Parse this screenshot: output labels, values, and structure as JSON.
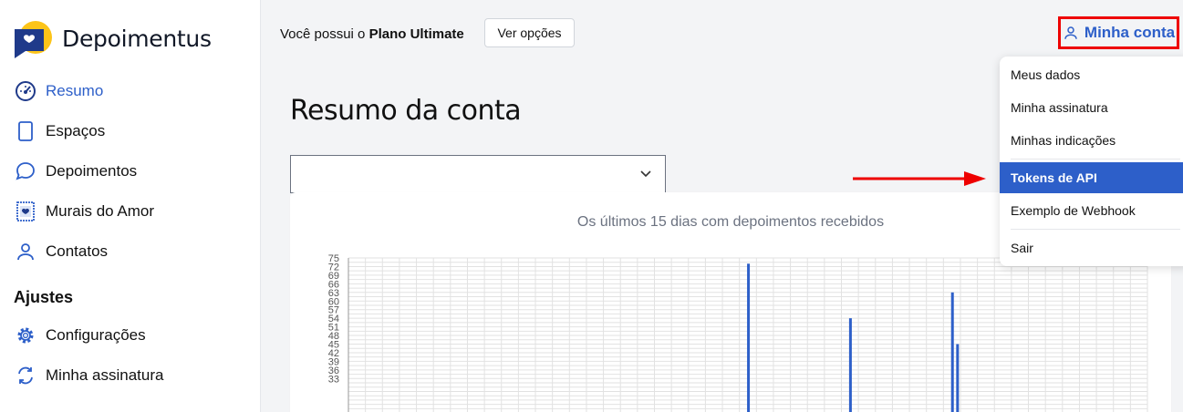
{
  "brand": {
    "name": "Depoimentus"
  },
  "sidebar": {
    "items": [
      {
        "label": "Resumo",
        "icon": "gauge-icon",
        "active": true
      },
      {
        "label": "Espaços",
        "icon": "tablet-icon"
      },
      {
        "label": "Depoimentos",
        "icon": "chat-bubble-icon"
      },
      {
        "label": "Murais do Amor",
        "icon": "heart-frame-icon"
      },
      {
        "label": "Contatos",
        "icon": "user-icon"
      }
    ],
    "section_title": "Ajustes",
    "settings_items": [
      {
        "label": "Configurações",
        "icon": "gear-icon"
      },
      {
        "label": "Minha assinatura",
        "icon": "refresh-icon"
      }
    ]
  },
  "topbar": {
    "plan_prefix": "Você possui o",
    "plan_name": "Plano Ultimate",
    "options_button": "Ver opções",
    "account_button": "Minha conta"
  },
  "main": {
    "title": "Resumo da conta",
    "select_value": ""
  },
  "dropdown": {
    "items": [
      "Meus dados",
      "Minha assinatura",
      "Minhas indicações",
      "Tokens de API",
      "Exemplo de Webhook",
      "Sair"
    ],
    "active": "Tokens de API"
  },
  "colors": {
    "accent": "#2d5fc9",
    "highlight": "#e00000"
  },
  "chart_data": {
    "type": "bar",
    "title": "Os últimos 15 dias com depoimentos recebidos",
    "y_ticks": [
      75,
      72,
      69,
      66,
      63,
      60,
      57,
      54,
      51,
      48,
      45,
      42,
      39,
      36,
      33
    ],
    "ylim": [
      33,
      75
    ],
    "bars": [
      {
        "x_index": 23,
        "value": 73
      },
      {
        "x_index": 29,
        "value": 54
      },
      {
        "x_index": 35,
        "value": 63
      },
      {
        "x_index": 35.3,
        "value": 45
      }
    ]
  }
}
